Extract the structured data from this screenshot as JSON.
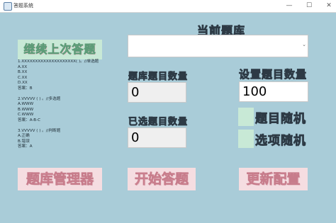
{
  "window": {
    "title": "答题系统",
    "minimize": "—",
    "maximize": "☐",
    "close": "✕"
  },
  "buttons": {
    "continue_last": "继续上次答题",
    "bank_manager": "题库管理器",
    "start_answer": "开始答题",
    "update_config": "更新配置"
  },
  "current_bank": {
    "label": "当前题库",
    "value": "",
    "arrow": "⌄"
  },
  "bank_count": {
    "label": "题库题目数量",
    "value": "0"
  },
  "set_count": {
    "label": "设置题目数量",
    "value": "100"
  },
  "selected_count": {
    "label": "已选题目数量",
    "value": "0"
  },
  "options": {
    "random_questions": {
      "label": "题目随机",
      "checked": false
    },
    "random_choices": {
      "label": "选项随机",
      "checked": false
    }
  },
  "preview": {
    "lines": [
      "1.XXXXXXXXXXXXXXXXXXXX( )。//单选题",
      "A.XX",
      "B.XX",
      "C.XX",
      "D.XX",
      "答案：B",
      "",
      "2.VVVVV ( ) 。//多选题",
      "A.WWW",
      "B.WWW",
      "C.WWW",
      "答案：A-B-C",
      "",
      "3.VVVVV ( ) 。//判断题",
      "A.正确",
      "B.错误",
      "答案：A"
    ]
  }
}
